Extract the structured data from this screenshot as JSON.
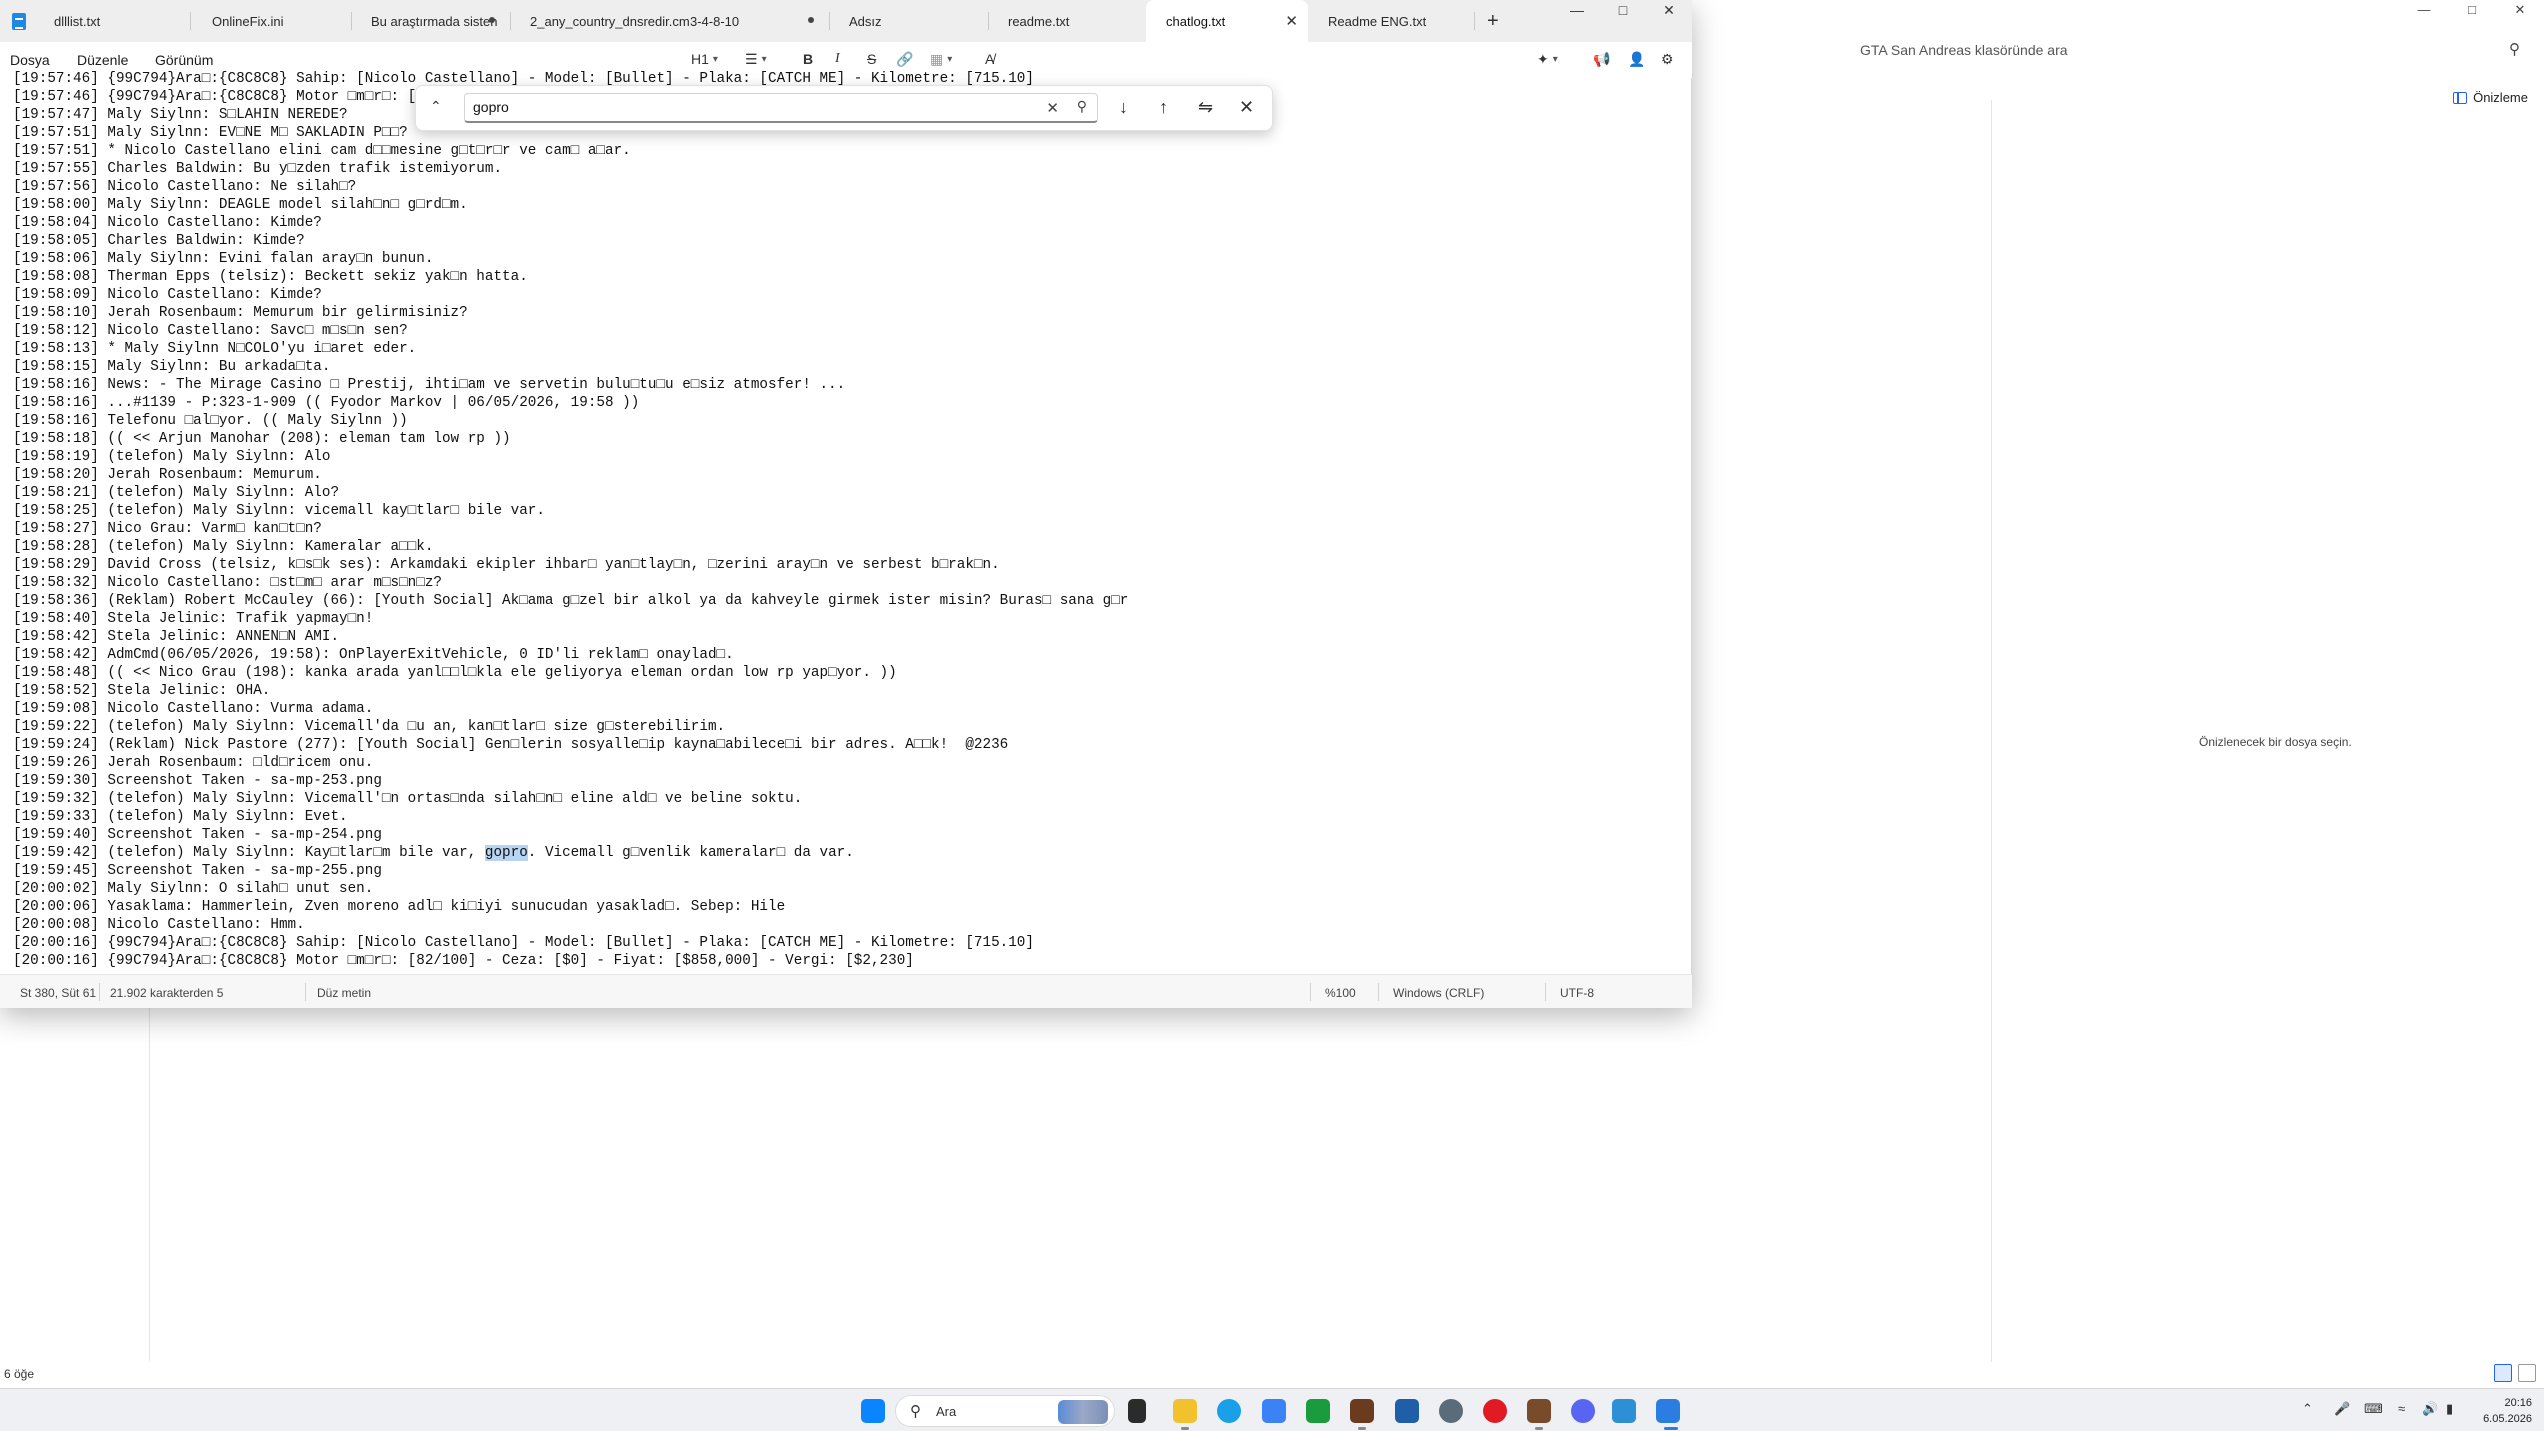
{
  "explorer": {
    "search_placeholder": "GTA San Andreas klasöründe ara",
    "preview_button": "Önizleme",
    "preview_message": "Önizlenecek bir dosya seçin.",
    "status": "6 öğe"
  },
  "notepad": {
    "tabs": [
      {
        "label": "dlllist.txt"
      },
      {
        "label": "OnlineFix.ini"
      },
      {
        "label": "Bu araştırmada sisten"
      },
      {
        "label": "2_any_country_dnsredir.cm",
        "extra": "3-4-8-10"
      },
      {
        "label": "Adsız"
      },
      {
        "label": "readme.txt"
      },
      {
        "label": "chatlog.txt"
      },
      {
        "label": "Readme ENG.txt"
      }
    ],
    "menu": {
      "file": "Dosya",
      "edit": "Düzenle",
      "view": "Görünüm"
    },
    "toolbar": {
      "heading": "H1",
      "list": "list-icon",
      "bold": "B",
      "italic": "I",
      "strike": "S",
      "link": "link-icon",
      "table": "table-icon",
      "clear_format": "clear-format-icon",
      "copilot": "copilot-icon",
      "megaphone": "megaphone-icon",
      "account": "account-icon",
      "settings": "gear-icon"
    },
    "find": {
      "query": "gopro"
    },
    "lines": [
      "[19:57:46] {99C794}Ara\u0000:{C8C8C8} Sahip: [Nicolo Castellano] - Model: [Bullet] - Plaka: [CATCH ME] - Kilometre: [715.10]",
      "[19:57:46] {99C794}Ara\u0000:{C8C8C8} Motor \u0000m\u0000r\u0000: [82/100] - Ceza: [$0] - Fiyat: [$858,000] - Vergi: [$2,230]",
      "[19:57:47] Maly Siylnn: S\u0000LAHIN NEREDE?",
      "[19:57:51] Maly Siylnn: EV\u0000NE M\u0000 SAKLADIN P\u0000\u0000?",
      "[19:57:51] * Nicolo Castellano elini cam d\u0000\u0000mesine g\u0000t\u0000r\u0000r ve cam\u0000 a\u0000ar.",
      "[19:57:55] Charles Baldwin: Bu y\u0000zden trafik istemiyorum.",
      "[19:57:56] Nicolo Castellano: Ne silah\u0000?",
      "[19:58:00] Maly Siylnn: DEAGLE model silah\u0000n\u0000 g\u0000rd\u0000m.",
      "[19:58:04] Nicolo Castellano: Kimde?",
      "[19:58:05] Charles Baldwin: Kimde?",
      "[19:58:06] Maly Siylnn: Evini falan aray\u0000n bunun.",
      "[19:58:08] Therman Epps (telsiz): Beckett sekiz yak\u0000n hatta.",
      "[19:58:09] Nicolo Castellano: Kimde?",
      "[19:58:10] Jerah Rosenbaum: Memurum bir gelirmisiniz?",
      "[19:58:12] Nicolo Castellano: Savc\u0000 m\u0000s\u0000n sen?",
      "[19:58:13] * Maly Siylnn N\u0000COLO'yu i\u0000aret eder.",
      "[19:58:15] Maly Siylnn: Bu arkada\u0000ta.",
      "[19:58:16] News: - The Mirage Casino \u0000 Prestij, ihti\u0000am ve servetin bulu\u0000tu\u0000u e\u0000siz atmosfer! ...",
      "[19:58:16] ...#1139 - P:323-1-909 (( Fyodor Markov | 06/05/2026, 19:58 ))",
      "[19:58:16] Telefonu \u0000al\u0000yor. (( Maly Siylnn ))",
      "[19:58:18] (( << Arjun Manohar (208): eleman tam low rp ))",
      "[19:58:19] (telefon) Maly Siylnn: Alo",
      "[19:58:20] Jerah Rosenbaum: Memurum.",
      "[19:58:21] (telefon) Maly Siylnn: Alo?",
      "[19:58:25] (telefon) Maly Siylnn: vicemall kay\u0000tlar\u0000 bile var.",
      "[19:58:27] Nico Grau: Varm\u0000 kan\u0000t\u0000n?",
      "[19:58:28] (telefon) Maly Siylnn: Kameralar a\u0000\u0000k.",
      "[19:58:29] David Cross (telsiz, k\u0000s\u0000k ses): Arkamdaki ekipler ihbar\u0000 yan\u0000tlay\u0000n, \u0000zerini aray\u0000n ve serbest b\u0000rak\u0000n.",
      "[19:58:32] Nicolo Castellano: \u0000st\u0000m\u0000 arar m\u0000s\u0000n\u0000z?",
      "[19:58:36] (Reklam) Robert McCauley (66): [Youth Social] Ak\u0000ama g\u0000zel bir alkol ya da kahveyle girmek ister misin? Buras\u0000 sana g\u0000r",
      "[19:58:40] Stela Jelinic: Trafik yapmay\u0000n!",
      "[19:58:42] Stela Jelinic: ANNEN\u0000N AMI.",
      "[19:58:42] AdmCmd(06/05/2026, 19:58): OnPlayerExitVehicle, 0 ID'li reklam\u0000 onaylad\u0000.",
      "[19:58:48] (( << Nico Grau (198): kanka arada yanl\u0000\u0000l\u0000kla ele geliyorya eleman ordan low rp yap\u0000yor. ))",
      "[19:58:52] Stela Jelinic: OHA.",
      "[19:59:08] Nicolo Castellano: Vurma adama.",
      "[19:59:22] (telefon) Maly Siylnn: Vicemall'da \u0000u an, kan\u0000tlar\u0000 size g\u0000sterebilirim.",
      "[19:59:24] (Reklam) Nick Pastore (277): [Youth Social] Gen\u0000lerin sosyalle\u0000ip kayna\u0000abilece\u0000i bir adres. A\u0000\u0000k!  @2236",
      "[19:59:26] Jerah Rosenbaum: \u0000ld\u0000ricem onu.",
      "[19:59:30] Screenshot Taken - sa-mp-253.png",
      "[19:59:32] (telefon) Maly Siylnn: Vicemall'\u0000n ortas\u0000nda silah\u0000n\u0000 eline ald\u0000 ve beline soktu.",
      "[19:59:33] (telefon) Maly Siylnn: Evet.",
      "[19:59:40] Screenshot Taken - sa-mp-254.png",
      "[19:59:42] (telefon) Maly Siylnn: Kay\u0000tlar\u0000m bile var, gopro. Vicemall g\u0000venlik kameralar\u0000 da var.",
      "[19:59:45] Screenshot Taken - sa-mp-255.png",
      "[20:00:02] Maly Siylnn: O silah\u0000 unut sen.",
      "[20:00:06] Yasaklama: Hammerlein, Zven moreno adl\u0000 ki\u0000iyi sunucudan yasaklad\u0000. Sebep: Hile",
      "[20:00:08] Nicolo Castellano: Hmm.",
      "[20:00:16] {99C794}Ara\u0000:{C8C8C8} Sahip: [Nicolo Castellano] - Model: [Bullet] - Plaka: [CATCH ME] - Kilometre: [715.10]",
      "[20:00:16] {99C794}Ara\u0000:{C8C8C8} Motor \u0000m\u0000r\u0000: [82/100] - Ceza: [$0] - Fiyat: [$858,000] - Vergi: [$2,230]"
    ],
    "status": {
      "position": "St 380, Süt 61",
      "chars": "21.902 karakterden 5",
      "format": "Düz metin",
      "zoom": "%100",
      "eol": "Windows (CRLF)",
      "encoding": "UTF-8"
    }
  },
  "taskbar": {
    "search_label": "Ara",
    "time": "20:16",
    "date": "6.05.2026"
  }
}
